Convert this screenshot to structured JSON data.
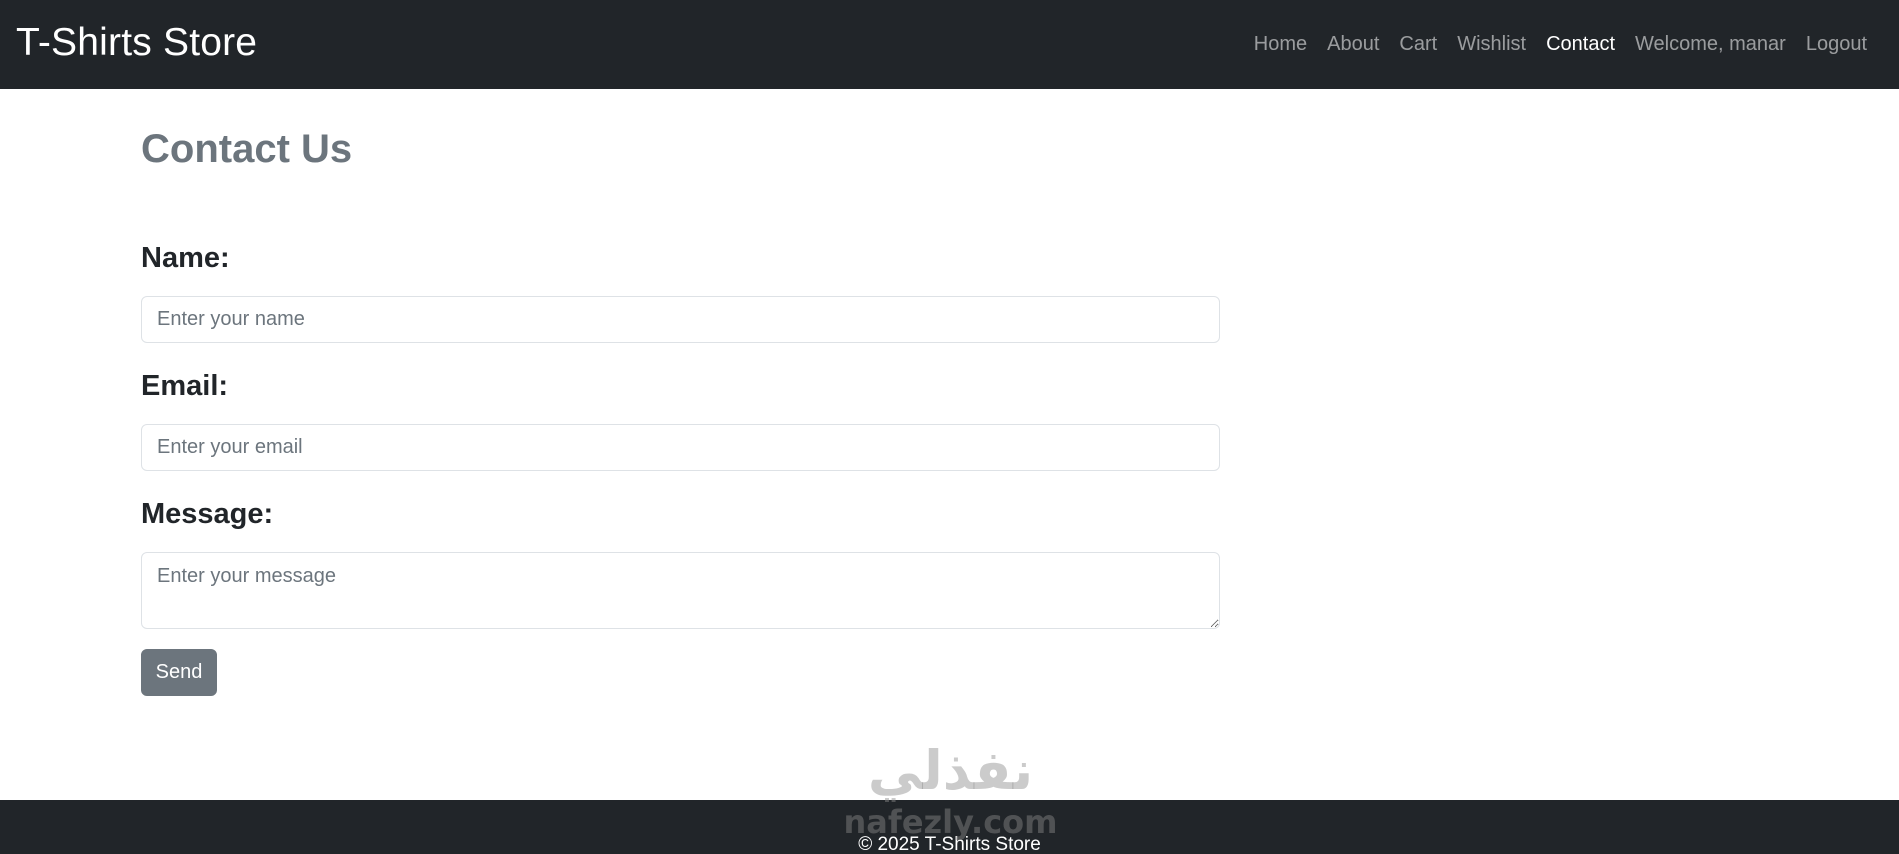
{
  "navbar": {
    "brand": "T-Shirts Store",
    "links": [
      {
        "label": "Home"
      },
      {
        "label": "About"
      },
      {
        "label": "Cart"
      },
      {
        "label": "Wishlist"
      },
      {
        "label": "Contact",
        "active": true
      }
    ],
    "welcome": "Welcome, manar",
    "logout": "Logout"
  },
  "page": {
    "title": "Contact Us"
  },
  "form": {
    "name_label": "Name:",
    "name_placeholder": "Enter your name",
    "email_label": "Email:",
    "email_placeholder": "Enter your email",
    "message_label": "Message:",
    "message_placeholder": "Enter your message",
    "send_label": "Send"
  },
  "watermark": {
    "glyph": "نفذلي",
    "url": "nafezly.com"
  },
  "footer": {
    "text": "© 2025 T-Shirts Store"
  },
  "colors": {
    "navbar_bg": "#212529",
    "title": "#6c757d",
    "button_bg": "#6c757d"
  }
}
